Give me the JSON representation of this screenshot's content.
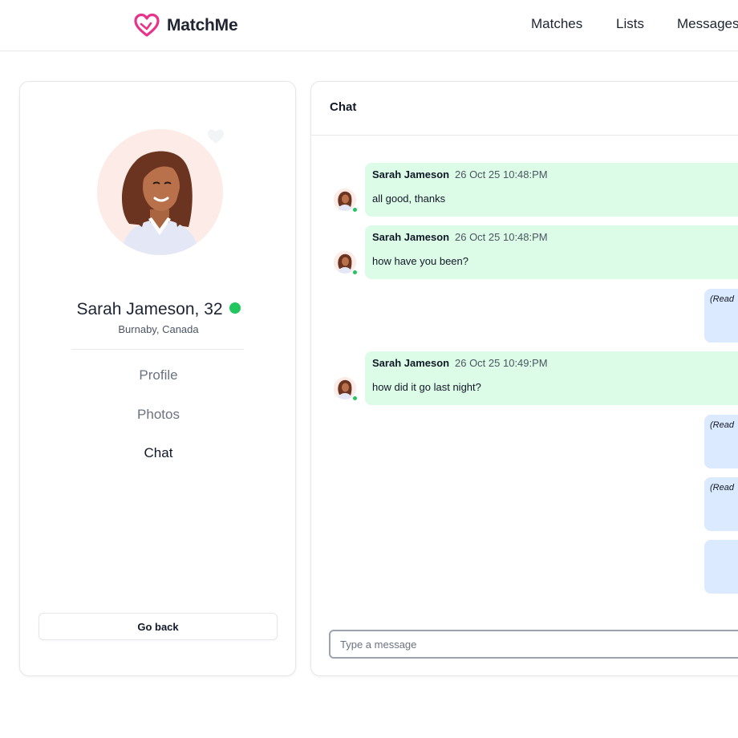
{
  "brand": {
    "name": "MatchMe",
    "color": "#e8338a",
    "icon": "heart-outline-icon"
  },
  "nav": {
    "matches": "Matches",
    "lists": "Lists",
    "messages": "Messages"
  },
  "profile": {
    "name_age": "Sarah Jameson, 32",
    "location": "Burnaby, Canada",
    "online": true,
    "online_color": "#22c55e",
    "menu": {
      "profile": "Profile",
      "photos": "Photos",
      "chat": "Chat"
    },
    "active_menu": "Chat",
    "go_back": "Go back"
  },
  "chat": {
    "title": "Chat",
    "input_placeholder": "Type a message",
    "incoming_color": "#dcfce7",
    "outgoing_color": "#dbeafe",
    "messages": [
      {
        "direction": "in",
        "sender": "Sarah Jameson",
        "time": "26 Oct 25 10:48:PM",
        "text": "all good, thanks"
      },
      {
        "direction": "in",
        "sender": "Sarah Jameson",
        "time": "26 Oct 25 10:48:PM",
        "text": "how have you been?"
      },
      {
        "direction": "out",
        "status": "(Read"
      },
      {
        "direction": "in",
        "sender": "Sarah Jameson",
        "time": "26 Oct 25 10:49:PM",
        "text": "how did it go last night?"
      },
      {
        "direction": "out",
        "status": "(Read"
      },
      {
        "direction": "out",
        "status": "(Read"
      },
      {
        "direction": "out",
        "status": ""
      }
    ]
  }
}
